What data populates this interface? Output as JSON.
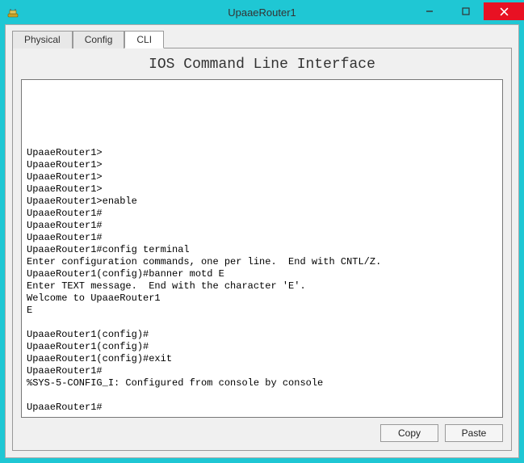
{
  "window": {
    "title": "UpaaeRouter1"
  },
  "tabs": {
    "physical": "Physical",
    "config": "Config",
    "cli": "CLI",
    "active": "cli"
  },
  "panel": {
    "title": "IOS Command Line Interface"
  },
  "terminal": {
    "text": "\n\n\n\n\n\nUpaaeRouter1>\nUpaaeRouter1>\nUpaaeRouter1>\nUpaaeRouter1>\nUpaaeRouter1>enable\nUpaaeRouter1#\nUpaaeRouter1#\nUpaaeRouter1#\nUpaaeRouter1#config terminal\nEnter configuration commands, one per line.  End with CNTL/Z.\nUpaaeRouter1(config)#banner motd E\nEnter TEXT message.  End with the character 'E'.\nWelcome to UpaaeRouter1\nE\n\nUpaaeRouter1(config)#\nUpaaeRouter1(config)#\nUpaaeRouter1(config)#exit\nUpaaeRouter1#\n%SYS-5-CONFIG_I: Configured from console by console\n\nUpaaeRouter1#"
  },
  "buttons": {
    "copy": "Copy",
    "paste": "Paste"
  }
}
